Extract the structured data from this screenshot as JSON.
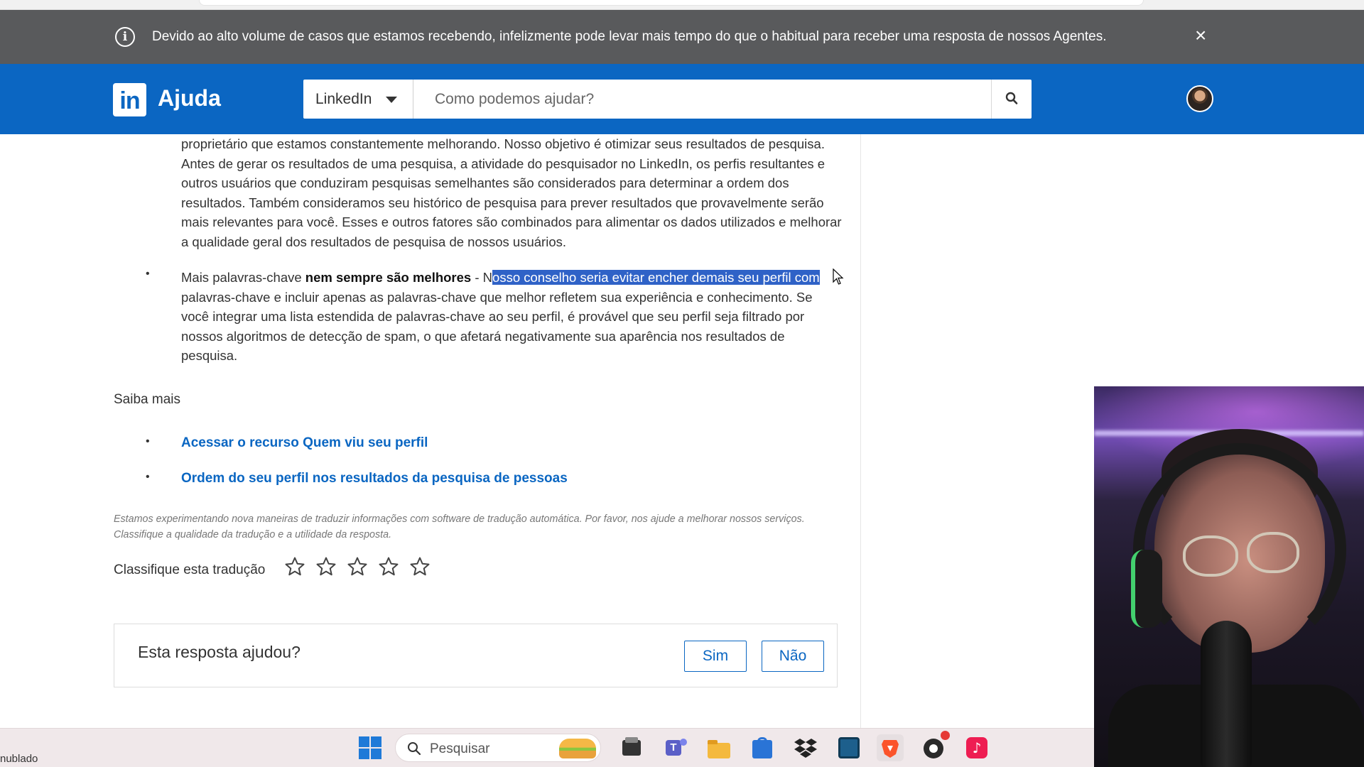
{
  "notice": {
    "message": "Devido ao alto volume de casos que estamos recebendo, infelizmente pode levar mais tempo do que o habitual para receber uma resposta de nossos Agentes.",
    "info_glyph": "i",
    "close_glyph": "×"
  },
  "header": {
    "logo_text": "in",
    "brand": "Ajuda",
    "scope_label": "LinkedIn",
    "search_placeholder": "Como podemos ajudar?"
  },
  "article": {
    "paragraph1": "proprietário que estamos constantemente melhorando. Nosso objetivo é otimizar seus resultados de pesquisa. Antes de gerar os resultados de uma pesquisa, a atividade do pesquisador no LinkedIn, os perfis resultantes e outros usuários que conduziram pesquisas semelhantes são considerados para determinar a ordem dos resultados. Também consideramos seu histórico de pesquisa para prever resultados que provavelmente serão mais relevantes para você. Esses e outros fatores são combinados para alimentar os dados utilizados e melhorar a qualidade geral dos resultados de pesquisa de nossos usuários.",
    "bullet_glyph": "•",
    "bullet_intro": "Mais palavras-chave ",
    "bullet_bold": "nem sempre são melhores",
    "bullet_dash": " - N",
    "bullet_highlight": "osso conselho seria evitar encher demais seu perfil com",
    "bullet_rest": " palavras-chave e incluir apenas as palavras-chave que melhor refletem sua experiência e conhecimento. Se você integrar uma lista estendida de palavras-chave ao seu perfil, é provável que seu perfil seja filtrado por nossos algoritmos de detecção de spam, o que afetará negativamente sua aparência nos resultados de pesquisa."
  },
  "learn_more": {
    "heading": "Saiba mais",
    "links": [
      "Acessar o recurso Quem viu seu perfil",
      "Ordem do seu perfil nos resultados da pesquisa de pessoas"
    ]
  },
  "translation": {
    "disclaimer": "Estamos experimentando nova maneiras de traduzir informações com software de tradução automática. Por favor, nos ajude a melhorar nossos serviços. Classifique a qualidade da tradução e a utilidade da resposta.",
    "rate_label": "Classifique esta tradução",
    "stars_selected": 0,
    "stars_total": 5
  },
  "feedback": {
    "question": "Esta resposta ajudou?",
    "yes": "Sim",
    "no": "Não"
  },
  "taskbar": {
    "weather": "nublado",
    "search_label": "Pesquisar",
    "apps": [
      "windows-start-icon",
      "file-explorer-icon",
      "teams-icon",
      "folder-icon",
      "store-icon",
      "dropbox-icon",
      "terminal-icon",
      "brave-icon",
      "obs-icon",
      "tiktok-icon"
    ]
  },
  "colors": {
    "brand_blue": "#0b66c2",
    "notice_bg": "#595a5c",
    "highlight": "#2f62c7"
  }
}
